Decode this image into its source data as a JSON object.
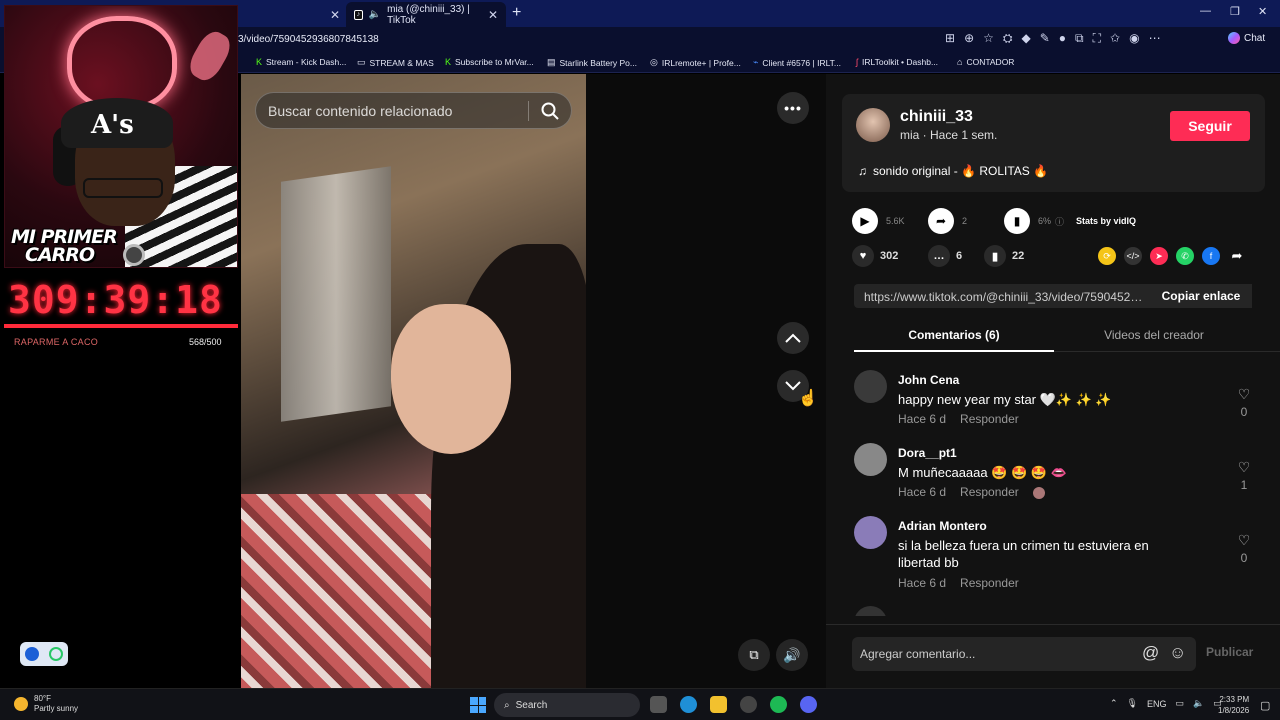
{
  "browser": {
    "active_tab_title": "mia (@chiniii_33) | TikTok",
    "url": "3/video/7590452936807845138",
    "chat_label": "Chat",
    "bookmarks": [
      {
        "label": "Stream - Kick Dash..."
      },
      {
        "label": "STREAM & MAS"
      },
      {
        "label": "Subscribe to MrVar..."
      },
      {
        "label": "Starlink Battery Po..."
      },
      {
        "label": "IRLremote+ | Profe..."
      },
      {
        "label": "Client #6576 | IRLT..."
      },
      {
        "label": "IRLToolkit • Dashb..."
      },
      {
        "label": "CONTADOR"
      }
    ]
  },
  "overlay": {
    "caption_line1": "MI PRIMER",
    "caption_line2": "CARRO",
    "timer": "309:39:18",
    "goal_label": "RAPARME A CACO",
    "goal_count": "568/500",
    "goal_progress": 1.0,
    "accent": "#ff2a3a"
  },
  "tiktok": {
    "search_placeholder": "Buscar contenido relacionado",
    "author": {
      "username": "chiniii_33",
      "subline": "mia · Hace 1 sem.",
      "follow_label": "Seguir"
    },
    "sound": "sonido original - 🔥 ROLITAS 🔥",
    "stats": {
      "plays": "5.6K",
      "shares": "2",
      "engagement": "6%",
      "vidiq_label": "Stats by vidIQ"
    },
    "actions": {
      "likes": "302",
      "comments": "6",
      "saves": "22"
    },
    "link": {
      "url": "https://www.tiktok.com/@chiniii_33/video/7590452936807845138",
      "copy_label": "Copiar enlace"
    },
    "tabs": [
      "Comentarios (6)",
      "Videos del creador"
    ],
    "comments": [
      {
        "user": "John Cena",
        "text": "happy new year my star 🤍✨ ✨ ✨",
        "time": "Hace 6 d",
        "reply": "Responder",
        "likes": "0"
      },
      {
        "user": "Dora__pt1",
        "text": "M muñecaaaaa 🤩 🤩 🤩 👄",
        "time": "Hace 6 d",
        "reply": "Responder",
        "likes": "1"
      },
      {
        "user": "Adrian Montero",
        "text": "si la belleza fuera un crimen tu estuviera en libertad bb",
        "time": "Hace 6 d",
        "reply": "Responder",
        "likes": "0"
      }
    ],
    "comment_placeholder": "Agregar comentario...",
    "post_label": "Publicar",
    "brand_color": "#fe2c55"
  },
  "taskbar": {
    "temp": "80°F",
    "weather": "Partly sunny",
    "search_label": "Search",
    "lang": "ENG",
    "time": "2:33 PM",
    "date": "1/8/2026"
  }
}
